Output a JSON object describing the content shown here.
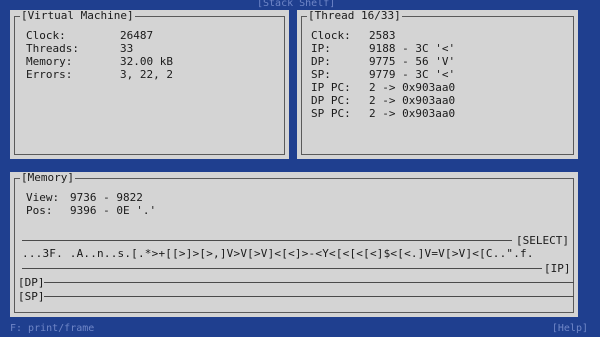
{
  "window_title": "[Stack Shelf]",
  "vm": {
    "title": "[Virtual Machine]",
    "rows": [
      {
        "label": "Clock:",
        "value": "26487"
      },
      {
        "label": "Threads:",
        "value": "33"
      },
      {
        "label": "Memory:",
        "value": "32.00 kB"
      },
      {
        "label": "Errors:",
        "value": "3, 22, 2"
      }
    ]
  },
  "thread": {
    "title": "[Thread 16/33]",
    "rows": [
      {
        "label": "Clock:",
        "value": "2583"
      },
      {
        "label": "IP:",
        "value": "9188 - 3C '<'"
      },
      {
        "label": "DP:",
        "value": "9775 - 56 'V'"
      },
      {
        "label": "SP:",
        "value": "9779 - 3C '<'"
      },
      {
        "label": "IP PC:",
        "value": "2 -> 0x903aa0"
      },
      {
        "label": "DP PC:",
        "value": "2 -> 0x903aa0"
      },
      {
        "label": "SP PC:",
        "value": "2 -> 0x903aa0"
      }
    ]
  },
  "memory": {
    "title": "[Memory]",
    "view_label": "View:",
    "view_value": "9736 - 9822",
    "pos_label": "Pos:",
    "pos_value": "9396 - 0E '.'",
    "select_tag": "[SELECT]",
    "tape": "...3F. .A..n..s.[.*>+[[>]>[>,]V>V[>V]<[<]>-<Y<[<[<[<]$<[<.]V=V[>V]<[C..\".f.",
    "ip_tag": "[IP]",
    "dp_tag": "[DP]",
    "sp_tag": "[SP]"
  },
  "footer": {
    "left": "F: print/frame",
    "right": "[Help]"
  }
}
